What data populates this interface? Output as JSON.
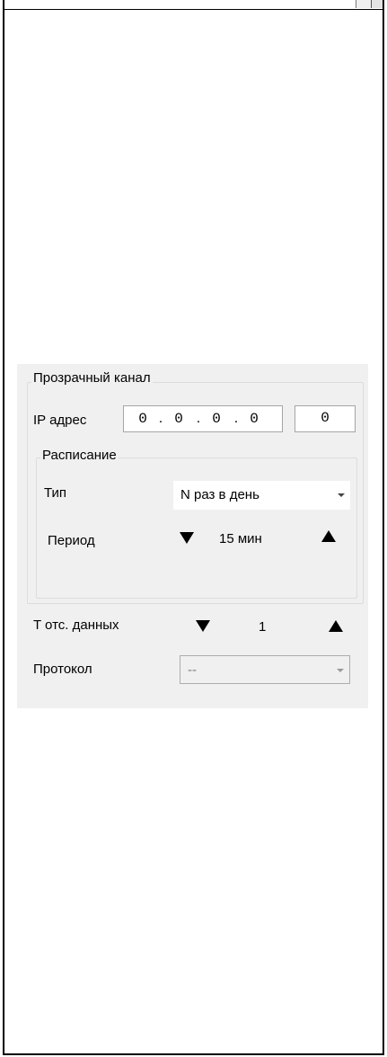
{
  "transparent_channel": {
    "title": "Прозрачный канал",
    "ip_label": "IP адрес",
    "ip_octets": [
      "0",
      "0",
      "0",
      "0"
    ],
    "port": "0"
  },
  "schedule": {
    "title": "Расписание",
    "type_label": "Тип",
    "type_value": "N раз в день",
    "period_label": "Период",
    "period_value": "15 мин"
  },
  "data_timeout": {
    "label": "T отс. данных",
    "value": "1"
  },
  "protocol": {
    "label": "Протокол",
    "value": "--"
  }
}
